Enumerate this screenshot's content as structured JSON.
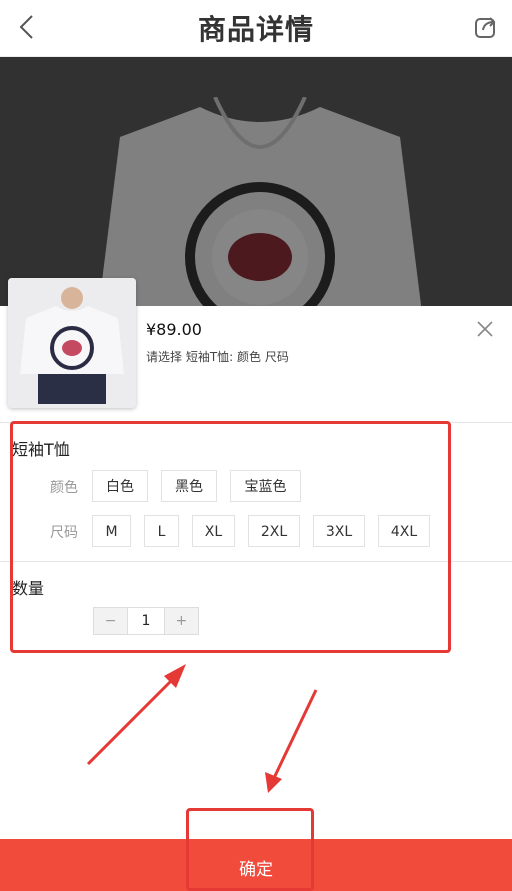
{
  "header": {
    "title": "商品详情",
    "back_icon": "chevron-left-icon",
    "share_icon": "share-icon"
  },
  "product": {
    "price": "¥89.00",
    "selection_hint": "请选择 短袖T恤: 颜色 尺码"
  },
  "sku": {
    "group_title": "短袖T恤",
    "color_label": "颜色",
    "colors": [
      "白色",
      "黑色",
      "宝蓝色"
    ],
    "size_label": "尺码",
    "sizes": [
      "M",
      "L",
      "XL",
      "2XL",
      "3XL",
      "4XL"
    ]
  },
  "quantity": {
    "label": "数量",
    "minus": "−",
    "value": "1",
    "plus": "+"
  },
  "footer": {
    "confirm_label": "确定"
  },
  "colors": {
    "accent": "#f14b3c",
    "annotation": "#e53935"
  }
}
